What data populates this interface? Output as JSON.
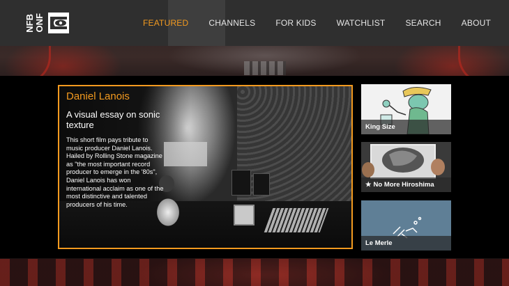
{
  "app": {
    "logo_line1": "NFB",
    "logo_line2": "ONF"
  },
  "nav": {
    "items": [
      {
        "label": "FEATURED",
        "active": true
      },
      {
        "label": "CHANNELS",
        "active": false
      },
      {
        "label": "FOR KIDS",
        "active": false
      },
      {
        "label": "WATCHLIST",
        "active": false
      },
      {
        "label": "SEARCH",
        "active": false
      },
      {
        "label": "ABOUT",
        "active": false
      }
    ]
  },
  "featured": {
    "title": "Daniel Lanois",
    "subtitle": "A visual essay on sonic texture",
    "description": "This short film pays tribute to music producer Daniel Lanois. Hailed by Rolling Stone magazine as \"the most important record producer to emerge in the '80s\", Daniel Lanois has won international acclaim as one of the most distinctive and talented producers of his time."
  },
  "tiles": [
    {
      "title": "King Size",
      "starred": false
    },
    {
      "title": "No More Hiroshima",
      "starred": true
    },
    {
      "title": "Le Merle",
      "starred": false
    }
  ],
  "colors": {
    "accent": "#f39a1f",
    "topbar": "#2f2f2f"
  }
}
